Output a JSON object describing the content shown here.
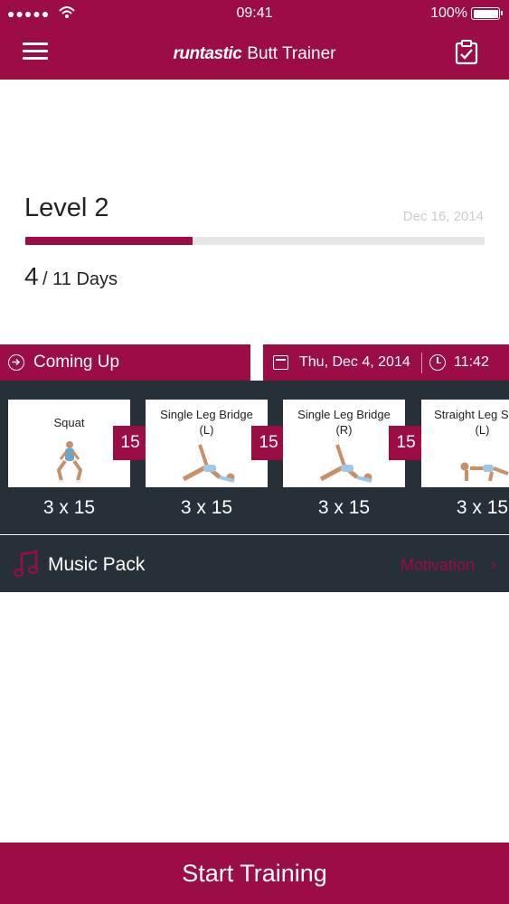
{
  "status_bar": {
    "signal": "●●●●●",
    "time": "09:41",
    "battery": "100%"
  },
  "nav": {
    "brand": "runtastic",
    "title": "Butt Trainer",
    "menu_icon": "hamburger-menu-icon",
    "right_icon": "checklist-icon"
  },
  "level": {
    "label": "Level 2",
    "date": "Dec 16, 2014",
    "progress_fraction": 0.364,
    "current_day": "4",
    "total_days": "/ 11 Days"
  },
  "coming_up": {
    "label": "Coming Up",
    "date": "Thu, Dec 4, 2014",
    "time": "11:42"
  },
  "exercises": [
    {
      "name": "Squat",
      "reps": "3 x 15"
    },
    {
      "name": "Single Leg Bridge (L)",
      "reps": "3 x 15"
    },
    {
      "name": "Single Leg Bridge (R)",
      "reps": "3 x 15"
    },
    {
      "name": "Straight Leg S Tap (L)",
      "reps": "3 x 15"
    }
  ],
  "rests": [
    "15 s",
    "15 s",
    "15 s"
  ],
  "music": {
    "label": "Music Pack",
    "value": "Motivation",
    "chevron": "›"
  },
  "start_button": "Start Training",
  "colors": {
    "accent": "#9b0d44",
    "dark_panel": "#263038",
    "progress_track": "#e6e6e6"
  }
}
